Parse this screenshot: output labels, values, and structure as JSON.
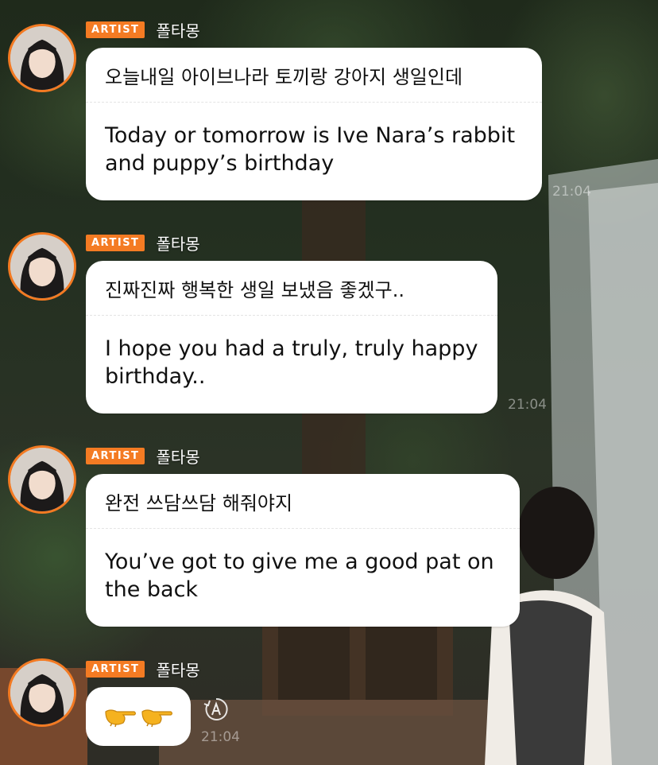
{
  "accent": "#f47b23",
  "messages": [
    {
      "badge": "ARTIST",
      "name": "폴타몽",
      "original": "오늘내일 아이브나라 토끼랑 강아지 생일인데",
      "translation_lines": [
        "Today or tomorrow is Ive Nara’s rabbit",
        "and puppy’s birthday"
      ],
      "time": "21:04"
    },
    {
      "badge": "ARTIST",
      "name": "폴타몽",
      "original": "진짜진짜 행복한 생일 보냈음 좋겠구..",
      "translation_lines": [
        "I hope you had a truly, truly happy",
        "birthday.."
      ],
      "time": "21:04"
    },
    {
      "badge": "ARTIST",
      "name": "폴타몽",
      "original": "완전 쓰담쓰담 해줘야지",
      "translation_lines": [
        "You’ve got to give me a good pat on",
        "the back"
      ],
      "time": ""
    },
    {
      "badge": "ARTIST",
      "name": "폴타몽",
      "emoji_icons": [
        "pointing-hand-emoji",
        "pointing-hand-emoji"
      ],
      "translate_icon": "translate-icon",
      "time": "21:04"
    }
  ]
}
